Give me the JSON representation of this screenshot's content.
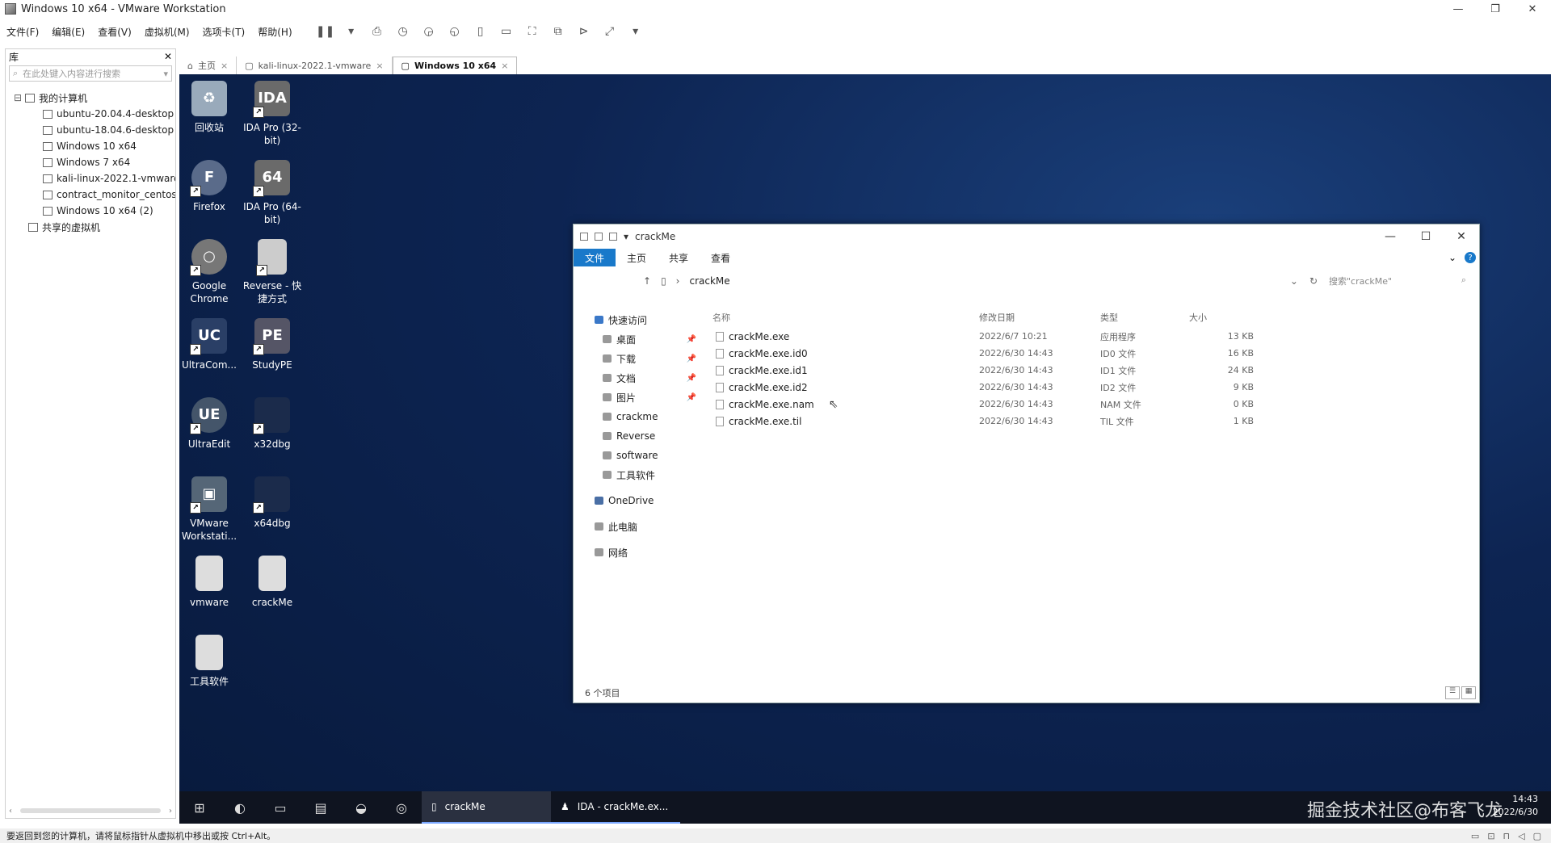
{
  "window": {
    "title": "Windows 10 x64 - VMware Workstation",
    "controls": [
      "—",
      "❐",
      "✕"
    ]
  },
  "menu": [
    "文件(F)",
    "编辑(E)",
    "查看(V)",
    "虚拟机(M)",
    "选项卡(T)",
    "帮助(H)"
  ],
  "library": {
    "title": "库",
    "close": "✕",
    "search_placeholder": "在此处键入内容进行搜索",
    "root": "我的计算机",
    "vms": [
      "ubuntu-20.04.4-desktop",
      "ubuntu-18.04.6-desktop",
      "Windows 10 x64",
      "Windows 7 x64",
      "kali-linux-2022.1-vmware",
      "contract_monitor_centos",
      "Windows 10 x64 (2)"
    ],
    "shared": "共享的虚拟机"
  },
  "tabs": [
    {
      "label": "主页",
      "active": false
    },
    {
      "label": "kali-linux-2022.1-vmware",
      "active": false
    },
    {
      "label": "Windows 10 x64",
      "active": true
    }
  ],
  "desktop_icons": [
    {
      "label": "回收站",
      "icon": "recycle-bin-icon",
      "color": "#9ab"
    },
    {
      "label": "IDA Pro (32-bit)",
      "icon": "ida-icon",
      "color": "#6a6a6a"
    },
    {
      "label": "Firefox",
      "icon": "firefox-icon",
      "color": "#5a6b8a"
    },
    {
      "label": "IDA Pro (64-bit)",
      "icon": "ida-icon",
      "color": "#6a6a6a"
    },
    {
      "label": "Google Chrome",
      "icon": "chrome-icon",
      "color": "#777"
    },
    {
      "label": "Reverse - 快捷方式",
      "icon": "folder-icon",
      "color": "#ccc"
    },
    {
      "label": "UltraCom...",
      "icon": "ultracompare-icon",
      "color": "#2a3f66"
    },
    {
      "label": "StudyPE",
      "icon": "studype-icon",
      "color": "#556"
    },
    {
      "label": "UltraEdit",
      "icon": "ultraedit-icon",
      "color": "#44556a"
    },
    {
      "label": "x32dbg",
      "icon": "x32dbg-icon",
      "color": "#1b2b4b"
    },
    {
      "label": "VMware Workstati...",
      "icon": "vmware-icon",
      "color": "#556677"
    },
    {
      "label": "x64dbg",
      "icon": "x64dbg-icon",
      "color": "#1b2b4b"
    },
    {
      "label": "vmware",
      "icon": "folder-icon",
      "color": "#ddd"
    },
    {
      "label": "crackMe",
      "icon": "folder-icon",
      "color": "#ddd"
    },
    {
      "label": "工具软件",
      "icon": "folder-icon",
      "color": "#ddd"
    }
  ],
  "explorer": {
    "title": "crackMe",
    "controls": [
      "—",
      "☐",
      "✕"
    ],
    "ribbon": [
      "文件",
      "主页",
      "共享",
      "查看"
    ],
    "help": "?",
    "path": "crackMe",
    "search_placeholder": "搜索\"crackMe\"",
    "nav": [
      {
        "label": "快速访问",
        "level": "root",
        "pin": false
      },
      {
        "label": "桌面",
        "level": "sub",
        "pin": true
      },
      {
        "label": "下载",
        "level": "sub",
        "pin": true
      },
      {
        "label": "文档",
        "level": "sub",
        "pin": true
      },
      {
        "label": "图片",
        "level": "sub",
        "pin": true
      },
      {
        "label": "crackme",
        "level": "sub",
        "pin": false
      },
      {
        "label": "Reverse",
        "level": "sub",
        "pin": false
      },
      {
        "label": "software",
        "level": "sub",
        "pin": false
      },
      {
        "label": "工具软件",
        "level": "sub",
        "pin": false
      },
      {
        "label": "OneDrive",
        "level": "root",
        "pin": false
      },
      {
        "label": "此电脑",
        "level": "root",
        "pin": false
      },
      {
        "label": "网络",
        "level": "root",
        "pin": false
      }
    ],
    "columns": [
      "名称",
      "修改日期",
      "类型",
      "大小"
    ],
    "files": [
      {
        "name": "crackMe.exe",
        "date": "2022/6/7 10:21",
        "type": "应用程序",
        "size": "13 KB"
      },
      {
        "name": "crackMe.exe.id0",
        "date": "2022/6/30 14:43",
        "type": "ID0 文件",
        "size": "16 KB"
      },
      {
        "name": "crackMe.exe.id1",
        "date": "2022/6/30 14:43",
        "type": "ID1 文件",
        "size": "24 KB"
      },
      {
        "name": "crackMe.exe.id2",
        "date": "2022/6/30 14:43",
        "type": "ID2 文件",
        "size": "9 KB"
      },
      {
        "name": "crackMe.exe.nam",
        "date": "2022/6/30 14:43",
        "type": "NAM 文件",
        "size": "0 KB"
      },
      {
        "name": "crackMe.exe.til",
        "date": "2022/6/30 14:43",
        "type": "TIL 文件",
        "size": "1 KB"
      }
    ],
    "status": "6 个项目"
  },
  "taskbar": {
    "tasks": [
      {
        "label": "crackMe",
        "active": true
      },
      {
        "label": "IDA - crackMe.ex...",
        "active": false
      }
    ],
    "time": "14:43",
    "date": "2022/6/30",
    "watermark": "掘金技术社区@布客飞龙"
  },
  "statusbar": "要返回到您的计算机，请将鼠标指针从虚拟机中移出或按 Ctrl+Alt。"
}
